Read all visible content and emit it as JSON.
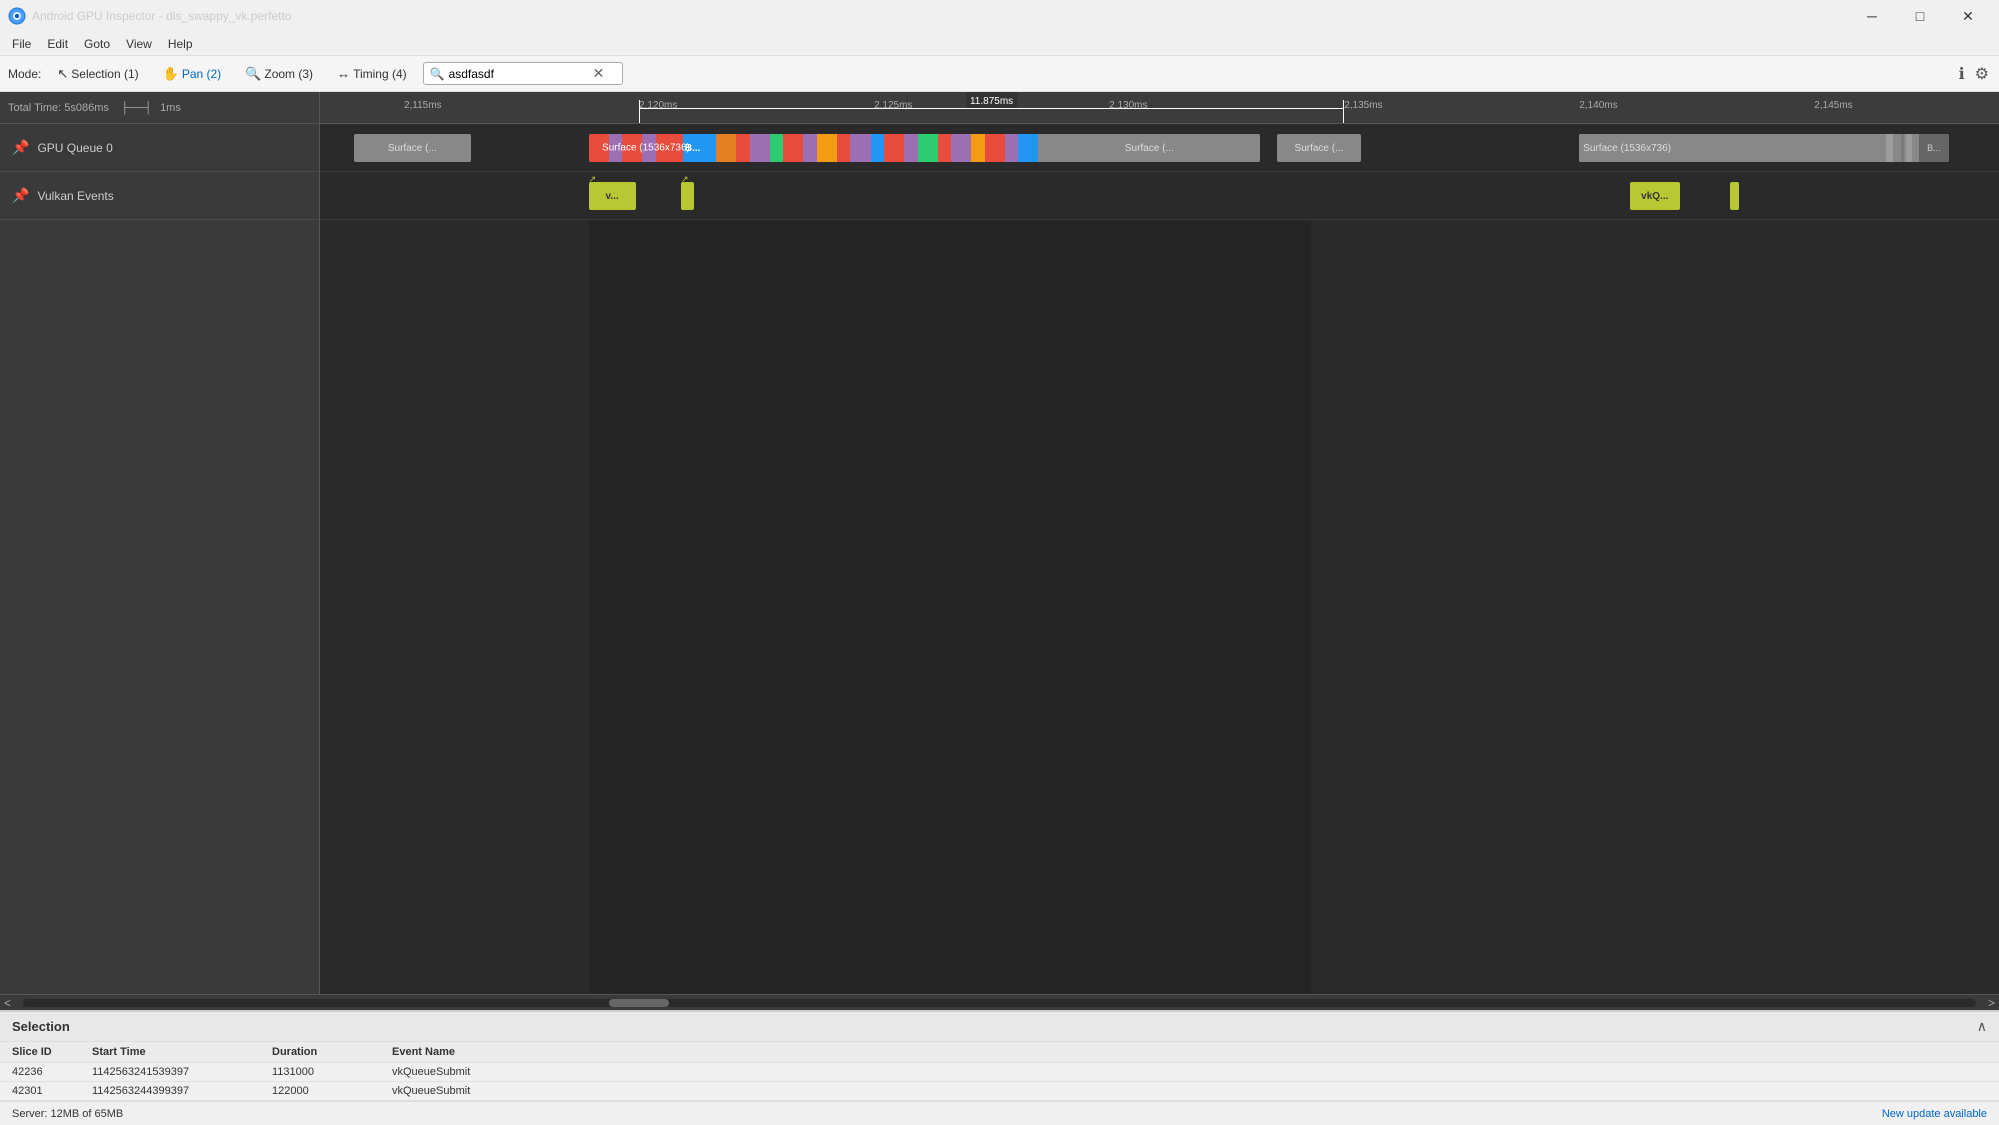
{
  "window": {
    "title": "Android GPU Inspector - dls_swappy_vk.perfetto",
    "app_icon_color": "#4a9eff"
  },
  "window_controls": {
    "minimize": "─",
    "maximize": "□",
    "close": "✕"
  },
  "menu": {
    "items": [
      "File",
      "Edit",
      "Goto",
      "View",
      "Help"
    ]
  },
  "toolbar": {
    "mode_label": "Mode:",
    "modes": [
      {
        "label": "Selection (1)",
        "icon": "↖",
        "id": "selection"
      },
      {
        "label": "Pan (2)",
        "icon": "✋",
        "id": "pan",
        "active": true
      },
      {
        "label": "Zoom (3)",
        "icon": "🔍",
        "id": "zoom"
      },
      {
        "label": "Timing (4)",
        "icon": "↔",
        "id": "timing"
      }
    ],
    "search_value": "asdfasdf",
    "search_placeholder": "Search...",
    "info_icon": "ℹ",
    "settings_icon": "⚙"
  },
  "timeline": {
    "total_time_label": "Total Time: 5s086ms",
    "scale_label": "1ms",
    "time_markers": [
      "2,115ms",
      "2,120ms",
      "2,125ms",
      "2,130ms",
      "2,135ms",
      "2,140ms",
      "2,145ms"
    ],
    "measurement": "11.875ms",
    "tracks": [
      {
        "id": "gpu-queue-0",
        "label": "GPU Queue 0",
        "pin": true
      },
      {
        "id": "vulkan-events",
        "label": "Vulkan Events",
        "pin": true
      }
    ],
    "gpu_segments": [
      {
        "label": "Surface (...",
        "color": "#888",
        "left_pct": 2,
        "width_pct": 7
      },
      {
        "label": "Surface (1536x736)",
        "color": "#9c6fb5",
        "left_pct": 31,
        "width_pct": 27
      },
      {
        "label": "B...",
        "color": "#2196F3",
        "left_pct": 36,
        "width_pct": 2.5
      },
      {
        "label": "Surface (...",
        "color": "#888",
        "left_pct": 56,
        "width_pct": 5
      },
      {
        "label": "Surface (1536x736)",
        "color": "#b0b0b0",
        "left_pct": 85,
        "width_pct": 12
      },
      {
        "label": "B...",
        "color": "#666",
        "left_pct": 87.5,
        "width_pct": 1
      }
    ],
    "vulkan_segments": [
      {
        "label": "v...",
        "color": "#b8c832",
        "left_pct": 32,
        "width_pct": 2.5
      },
      {
        "label": "",
        "color": "#b8c832",
        "left_pct": 38.5,
        "width_pct": 0.8
      },
      {
        "label": "vkQ...",
        "color": "#b8c832",
        "left_pct": 78,
        "width_pct": 3
      },
      {
        "label": "",
        "color": "#b8c832",
        "left_pct": 84.5,
        "width_pct": 0.4
      }
    ]
  },
  "selection_panel": {
    "title": "Selection",
    "columns": [
      "Slice ID",
      "Start Time",
      "Duration",
      "Event Name"
    ],
    "rows": [
      {
        "slice_id": "42236",
        "start_time": "1142563241539397",
        "duration": "1131000",
        "event_name": "vkQueueSubmit"
      },
      {
        "slice_id": "42301",
        "start_time": "1142563244399397",
        "duration": "122000",
        "event_name": "vkQueueSubmit"
      }
    ],
    "collapse_icon": "∧"
  },
  "status_bar": {
    "server_info": "Server: 12MB of 65MB",
    "update_text": "New update available"
  }
}
